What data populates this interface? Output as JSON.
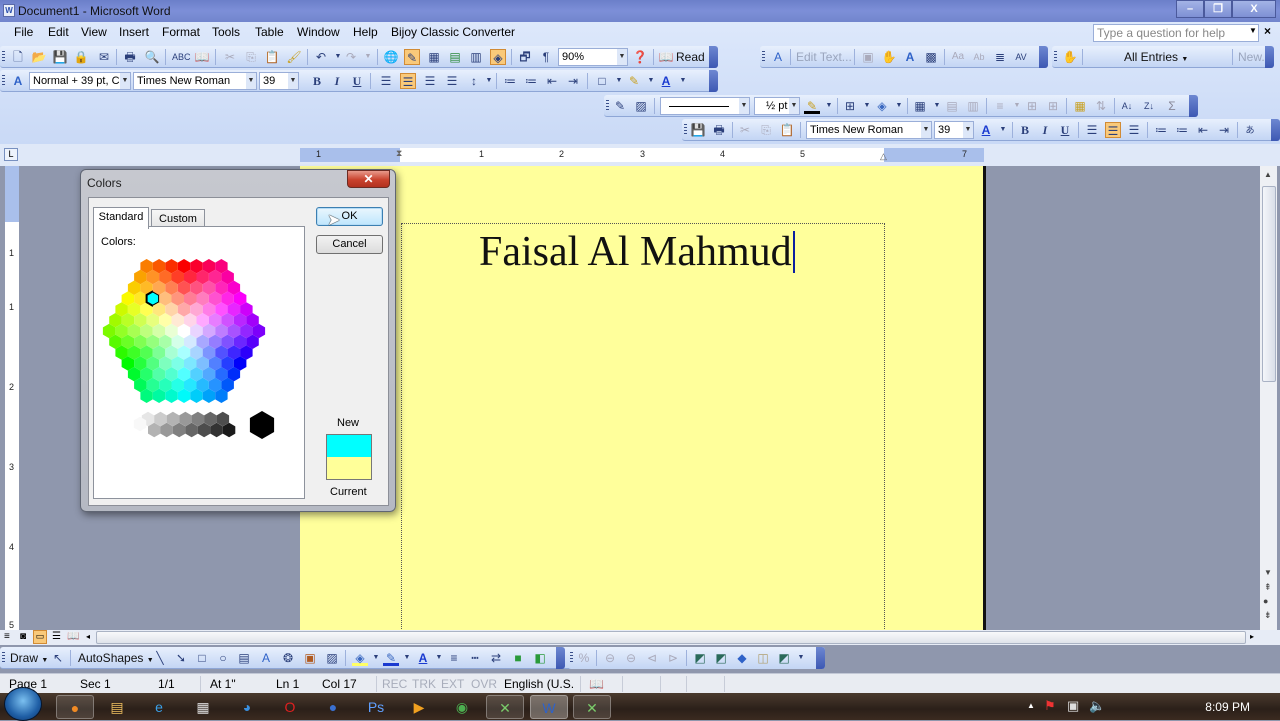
{
  "window": {
    "title": "Document1 - Microsoft Word",
    "app_icon": "word-doc-icon",
    "controls": {
      "minimize": "minimize-icon",
      "restore": "restore-icon",
      "close": "close-icon"
    }
  },
  "menu": {
    "items": [
      "File",
      "Edit",
      "View",
      "Insert",
      "Format",
      "Tools",
      "Table",
      "Window",
      "Help",
      "Bijoy Classic Converter"
    ],
    "help_placeholder": "Type a question for help"
  },
  "standard_toolbar": {
    "zoom": "90%",
    "read_label": "Read",
    "icons": [
      "new-icon",
      "open-icon",
      "save-icon",
      "permission-icon",
      "email-icon",
      "print-icon",
      "print-preview-icon",
      "spelling-icon",
      "research-icon",
      "cut-icon",
      "copy-icon",
      "paste-icon",
      "format-painter-icon",
      "undo-icon",
      "redo-icon",
      "hyperlink-icon",
      "tables-borders-icon",
      "insert-table-icon",
      "insert-excel-icon",
      "columns-icon",
      "drawing-icon",
      "document-map-icon",
      "show-hide-icon",
      "help-icon"
    ]
  },
  "formatting_toolbar": {
    "style": "Normal + 39 pt, C",
    "font": "Times New Roman",
    "size": "39",
    "icons": [
      "font-style-icon",
      "bold-icon",
      "italic-icon",
      "underline-icon",
      "align-left-icon",
      "align-center-icon",
      "align-right-icon",
      "justify-icon",
      "line-spacing-icon",
      "numbering-icon",
      "bullets-icon",
      "decrease-indent-icon",
      "increase-indent-icon",
      "borders-icon",
      "highlight-icon",
      "font-color-icon"
    ]
  },
  "wordart_toolbar": {
    "edit_text": "Edit Text...",
    "icons": [
      "insert-wordart-icon",
      "wordart-gallery-icon",
      "format-wordart-icon",
      "wordart-shape-icon",
      "text-wrapping-icon",
      "same-height-icon",
      "vertical-text-icon",
      "alignment-icon",
      "char-spacing-icon"
    ]
  },
  "autotext_toolbar": {
    "all_entries": "All Entries",
    "new": "New..."
  },
  "tables_toolbar": {
    "line_weight": "½ pt",
    "icons": [
      "draw-table-icon",
      "eraser-icon",
      "line-style-icon",
      "line-weight-icon",
      "border-color-icon",
      "outside-border-icon",
      "shading-icon",
      "insert-table-icon",
      "merge-cells-icon",
      "split-cells-icon",
      "align-icon",
      "distribute-rows-icon",
      "distribute-cols-icon",
      "autoformat-icon",
      "text-direction-icon",
      "sort-asc-icon",
      "sort-desc-icon",
      "autosum-icon"
    ]
  },
  "floating_toolbar": {
    "font": "Times New Roman",
    "size": "39"
  },
  "ruler": {
    "h_numbers": [
      "1",
      "1",
      "2",
      "3",
      "4",
      "5",
      "7"
    ],
    "v_numbers": [
      "1",
      "1",
      "2",
      "3",
      "4",
      "5"
    ],
    "tab_selector": "L"
  },
  "document": {
    "text": "Faisal Al Mahmud",
    "page_color": "#ffff9b"
  },
  "colors_dialog": {
    "title": "Colors",
    "close": "close-icon",
    "tabs": [
      "Standard",
      "Custom"
    ],
    "active_tab": "Standard",
    "colors_label": "Colors:",
    "ok": "OK",
    "cancel": "Cancel",
    "new_label": "New",
    "current_label": "Current",
    "new_color": "#00ffff",
    "current_color": "#ffff99",
    "selected_color": "#00ffff"
  },
  "draw_toolbar": {
    "draw": "Draw",
    "autoshapes": "AutoShapes",
    "icons": [
      "select-objects-icon",
      "line-icon",
      "arrow-icon",
      "rectangle-icon",
      "oval-icon",
      "textbox-icon",
      "wordart-icon",
      "diagram-icon",
      "clipart-icon",
      "picture-icon",
      "fill-color-icon",
      "line-color-icon",
      "font-color-icon",
      "line-style-icon",
      "dash-style-icon",
      "arrow-style-icon",
      "shadow-icon",
      "3d-icon"
    ]
  },
  "status_bar": {
    "page": "Page 1",
    "sec": "Sec 1",
    "pages": "1/1",
    "at": "At 1\"",
    "ln": "Ln 1",
    "col": "Col 17",
    "rec": "REC",
    "trk": "TRK",
    "ext": "EXT",
    "ovr": "OVR",
    "language": "English (U.S."
  },
  "taskbar": {
    "apps": [
      "firefox-icon",
      "explorer-icon",
      "internet-explorer-icon",
      "calendar-icon",
      "app-swirl-icon",
      "opera-icon",
      "media-icon",
      "photoshop-icon",
      "media-player-icon",
      "chrome-icon",
      "excel-icon",
      "word-icon",
      "excel-icon-2"
    ],
    "clock": "8:09 PM"
  }
}
